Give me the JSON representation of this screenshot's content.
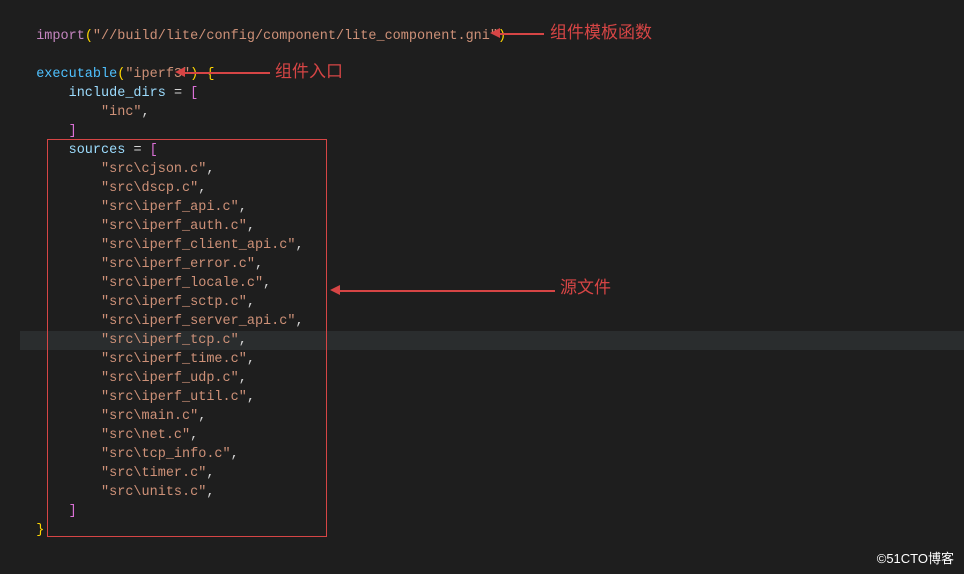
{
  "code": {
    "import_kw": "import",
    "import_arg": "\"//build/lite/config/component/lite_component.gni\"",
    "executable_kw": "executable",
    "executable_arg": "\"iperf3\"",
    "include_dirs_kw": "include_dirs",
    "include_value": "\"inc\"",
    "sources_kw": "sources",
    "sources": [
      "\"src\\cjson.c\"",
      "\"src\\dscp.c\"",
      "\"src\\iperf_api.c\"",
      "\"src\\iperf_auth.c\"",
      "\"src\\iperf_client_api.c\"",
      "\"src\\iperf_error.c\"",
      "\"src\\iperf_locale.c\"",
      "\"src\\iperf_sctp.c\"",
      "\"src\\iperf_server_api.c\"",
      "\"src\\iperf_tcp.c\"",
      "\"src\\iperf_time.c\"",
      "\"src\\iperf_udp.c\"",
      "\"src\\iperf_util.c\"",
      "\"src\\main.c\"",
      "\"src\\net.c\"",
      "\"src\\tcp_info.c\"",
      "\"src\\timer.c\"",
      "\"src\\units.c\""
    ]
  },
  "annotations": {
    "template_func": "组件模板函数",
    "entry": "组件入口",
    "source_files": "源文件"
  },
  "watermark": "©51CTO博客"
}
